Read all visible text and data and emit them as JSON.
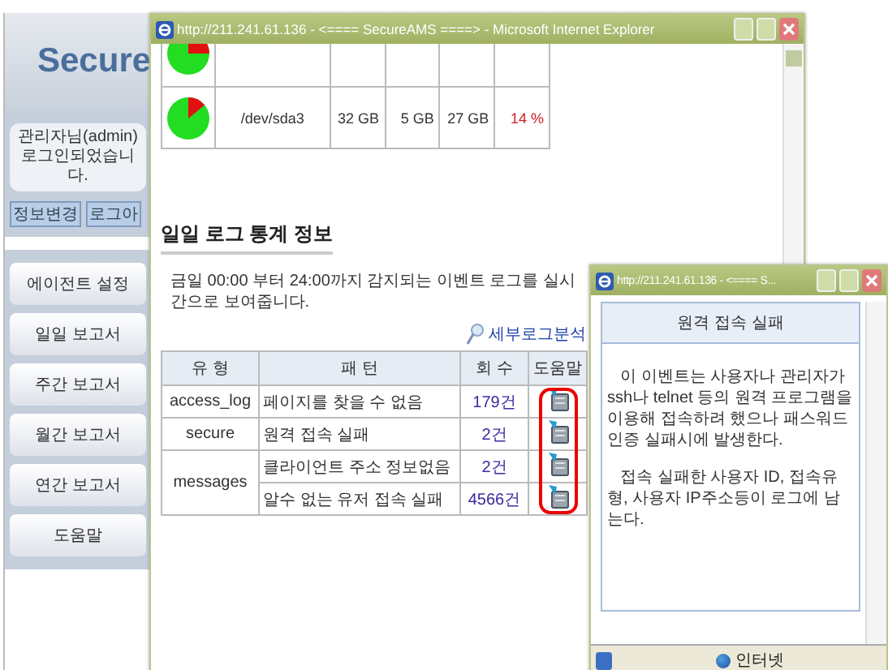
{
  "sidebar": {
    "logo": "Secure",
    "login_message": "관리자님(admin) 로그인되었습니다.",
    "buttons": [
      "정보변경",
      "로그아"
    ],
    "items": [
      {
        "label": "에이전트 설정"
      },
      {
        "label": "일일 보고서"
      },
      {
        "label": "주간 보고서"
      },
      {
        "label": "월간 보고서"
      },
      {
        "label": "연간 보고서"
      },
      {
        "label": "도움말"
      }
    ]
  },
  "main_window": {
    "title": "http://211.241.61.136 - <==== SecureAMS ====> - Microsoft Internet Explorer",
    "disks": [
      {
        "name": "/dev/sda3",
        "size": "32 GB",
        "used": "5 GB",
        "free": "27 GB",
        "percent": "14 %",
        "level": 0.14
      }
    ],
    "heading": "일일 로그 통계 정보",
    "description": "금일 00:00 부터 24:00까지 감지되는 이벤트 로그를 실시간으로 보여줍니다.",
    "detail_link": "세부로그분석",
    "table": {
      "columns": [
        "유 형",
        "패 턴",
        "회 수",
        "도움말"
      ],
      "groups": [
        {
          "type": "access_log",
          "rows": [
            {
              "pattern": "페이지를 찾을 수 없음",
              "count": "179건"
            }
          ]
        },
        {
          "type": "secure",
          "rows": [
            {
              "pattern": "원격 접속 실패",
              "count": "2건"
            }
          ]
        },
        {
          "type": "messages",
          "rows": [
            {
              "pattern": "클라이언트 주소 정보없음",
              "count": "2건"
            },
            {
              "pattern": "알수 없는 유저 접속 실패",
              "count": "4566건"
            }
          ]
        }
      ]
    }
  },
  "popup": {
    "title": "http://211.241.61.136 - <==== S...",
    "heading": "원격 접속 실패",
    "paragraphs": [
      "이 이벤트는 사용자나 관리자가 ssh나 telnet 등의 원격 프로그램을 이용해 접속하려 했으나 패스워드 인증 실패시에 발생한다.",
      "접속 실패한 사용자 ID, 접속유형, 사용자 IP주소등이 로그에 남는다."
    ],
    "status": "인터넷"
  }
}
